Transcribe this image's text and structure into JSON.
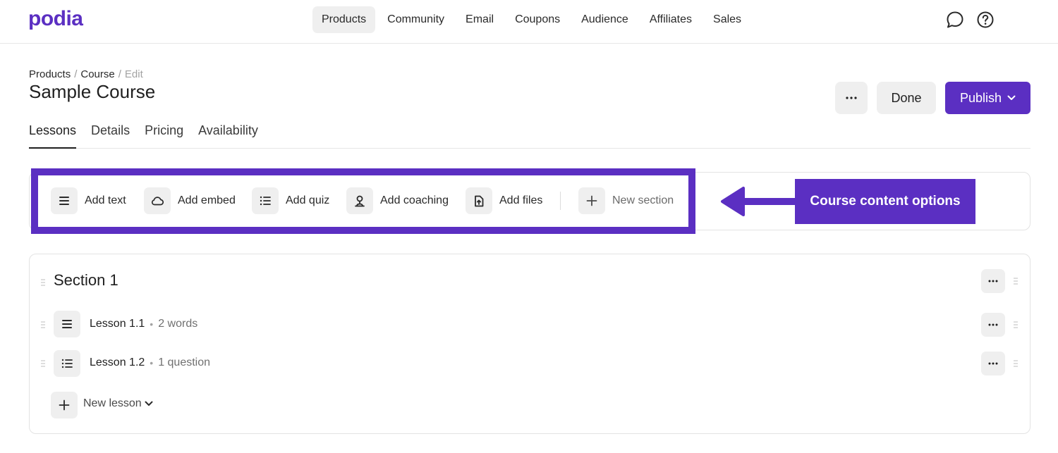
{
  "brand": {
    "logo": "podia",
    "accent": "#5b2fc2"
  },
  "nav": {
    "items": [
      {
        "label": "Products",
        "active": true
      },
      {
        "label": "Community",
        "active": false
      },
      {
        "label": "Email",
        "active": false
      },
      {
        "label": "Coupons",
        "active": false
      },
      {
        "label": "Audience",
        "active": false
      },
      {
        "label": "Affiliates",
        "active": false
      },
      {
        "label": "Sales",
        "active": false
      }
    ],
    "icons": [
      "chat-icon",
      "help-icon"
    ]
  },
  "header": {
    "breadcrumb": [
      "Products",
      "Course",
      "Edit"
    ],
    "title": "Sample Course",
    "done_label": "Done",
    "publish_label": "Publish"
  },
  "tabs": [
    {
      "label": "Lessons",
      "active": true
    },
    {
      "label": "Details",
      "active": false
    },
    {
      "label": "Pricing",
      "active": false
    },
    {
      "label": "Availability",
      "active": false
    }
  ],
  "toolbar": {
    "items": [
      {
        "label": "Add text",
        "icon": "text-lines-icon"
      },
      {
        "label": "Add embed",
        "icon": "cloud-icon"
      },
      {
        "label": "Add quiz",
        "icon": "list-icon"
      },
      {
        "label": "Add coaching",
        "icon": "person-icon"
      },
      {
        "label": "Add files",
        "icon": "file-upload-icon"
      },
      {
        "label": "New section",
        "icon": "plus-icon"
      }
    ]
  },
  "callout": {
    "label": "Course content options"
  },
  "section": {
    "title": "Section 1",
    "lessons": [
      {
        "title": "Lesson 1.1",
        "meta": "2 words",
        "icon": "text-lines-icon"
      },
      {
        "title": "Lesson 1.2",
        "meta": "1 question",
        "icon": "list-icon"
      }
    ],
    "new_lesson_label": "New lesson"
  }
}
